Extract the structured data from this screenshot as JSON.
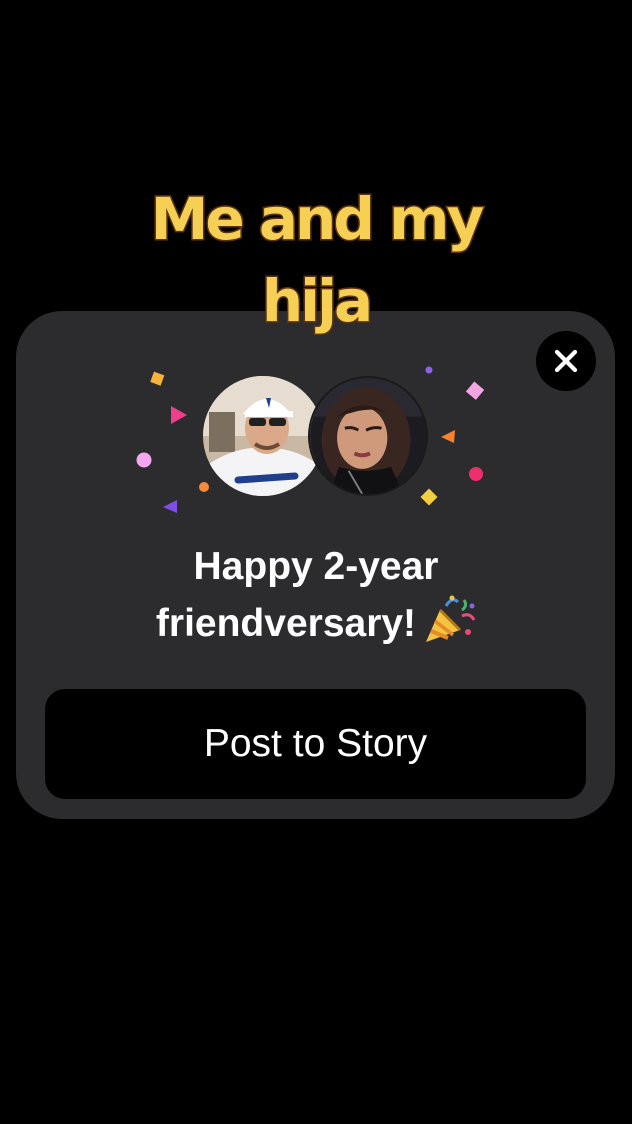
{
  "caption": {
    "line1": "Me and my",
    "line2": "hija"
  },
  "friendversary_card": {
    "message_line1": "Happy 2-year",
    "message_line2": "friendversary!",
    "emoji_icon": "party-popper-icon",
    "post_button_label": "Post to Story",
    "close_icon": "close-icon",
    "avatars": [
      {
        "icon": "profile-photo-man-dodgers-jersey"
      },
      {
        "icon": "profile-photo-woman"
      }
    ]
  },
  "colors": {
    "background": "#000000",
    "card": "#2c2c2e",
    "caption_fill": "#f6cf55",
    "caption_stroke": "#6b3a12",
    "button": "#000000",
    "text": "#ffffff"
  }
}
